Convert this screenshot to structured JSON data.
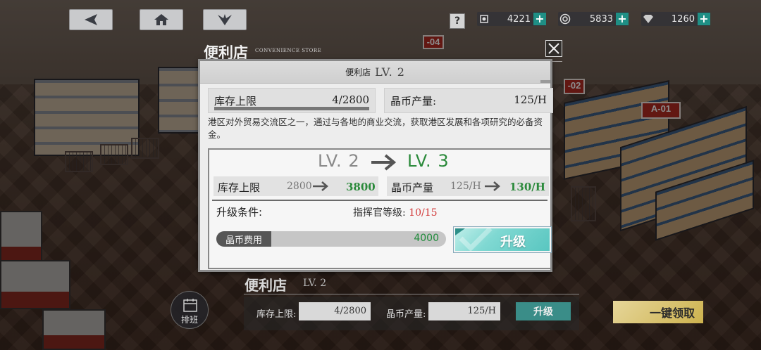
{
  "top_bar": {
    "back_icon": "back-arrow-icon",
    "home_icon": "home-icon",
    "menu_icon": "fleet-emblem-icon",
    "help_label": "?"
  },
  "resources": [
    {
      "icon": "commander-icon",
      "value": "4221",
      "plus": "+"
    },
    {
      "icon": "coin-icon",
      "value": "5833",
      "plus": "+"
    },
    {
      "icon": "gem-icon",
      "value": "1260",
      "plus": "+"
    }
  ],
  "dialog": {
    "title": "便利店",
    "subtitle": "CONVENIENCE STORE",
    "header_name": "便利店",
    "header_level": "LV. 2",
    "storage": {
      "label": "库存上限",
      "value": "4/2800",
      "fill": 0.0014
    },
    "production": {
      "label": "晶币产量:",
      "value": "125/H"
    },
    "description": "港区对外贸易交流区之一，通过与各地的商业交流，获取港区发展和各项研究的必备资金。",
    "upgrade": {
      "level_from": "LV. 2",
      "level_to": "LV. 3",
      "storage_label": "库存上限",
      "storage_from": "2800",
      "storage_to": "3800",
      "production_label": "晶币产量",
      "production_from": "125/H",
      "production_to": "130/H",
      "condition_label": "升级条件:",
      "condition_req": "指挥官等级:",
      "condition_val": "10/15",
      "cost_label": "晶币费用",
      "cost_value": "4000",
      "button_label": "升级"
    }
  },
  "bottom": {
    "title": "便利店",
    "level": "LV. 2",
    "storage_label": "库存上限:",
    "storage_value": "4/2800",
    "production_label": "晶币产量:",
    "production_value": "125/H",
    "upgrade_label": "升级",
    "claim_all_label": "一键领取",
    "schedule_label": "排班"
  },
  "scene_signs": [
    "A-01",
    "-02",
    "-04"
  ],
  "colors": {
    "accent_green": "#2b8a3b",
    "warning_red": "#d23a3a",
    "upgrade_teal": "#59c6c0"
  }
}
